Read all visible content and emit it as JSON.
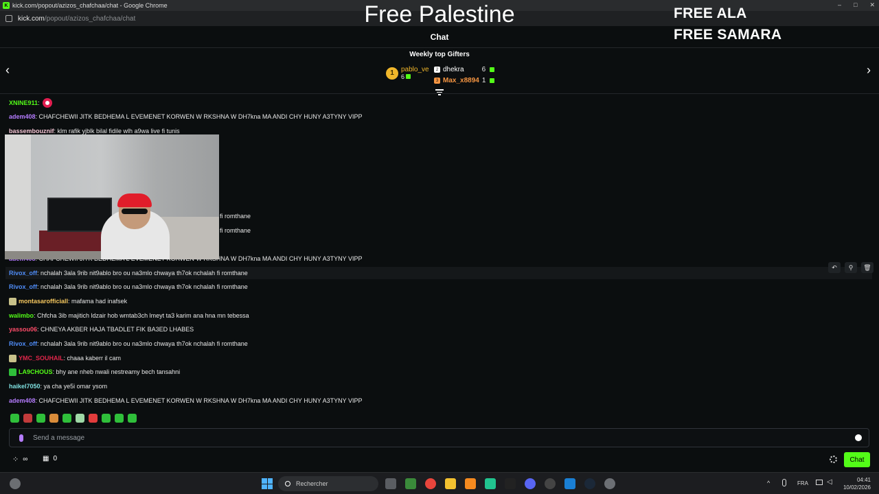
{
  "window": {
    "title": "kick.com/popout/azizos_chafchaa/chat - Google Chrome",
    "url_host": "kick.com",
    "url_path": "/popout/azizos_chafchaa/chat"
  },
  "overlay": {
    "center": "Free Palestine",
    "right_line1": "FREE ALA",
    "right_line2": "FREE SAMARA"
  },
  "chat_header": {
    "title": "Chat"
  },
  "gifters": {
    "title": "Weekly top Gifters",
    "items": [
      {
        "rank": "1",
        "name": "pablo_ve",
        "count": "6",
        "color": "#f1b72b"
      },
      {
        "rank": "2",
        "name": "dhekra",
        "count": "6",
        "color": "#ffffff"
      },
      {
        "rank": "3",
        "name": "Max_x8894",
        "count": "1",
        "color": "#f59542"
      }
    ]
  },
  "messages": [
    {
      "user": "XNINE911",
      "text": "",
      "color": "#53fc18",
      "emote": true
    },
    {
      "user": "adem408",
      "text": ": CHAFCHEWII JITK BEDHEMA L EVEMENET KORWEN W RKSHNA W DH7kna MA ANDI CHY HUNY A3TYNY VIPP",
      "color": "#b57cff"
    },
    {
      "user": "bassembouznif",
      "text": ": klm rafik yjblk bilal fidile wlh a9wa live fi tunis",
      "color": "#f6c6d6"
    },
    {
      "user": "",
      "text": "fi romthane",
      "color": "#e8e8e8"
    },
    {
      "user": "",
      "text": "fi romthane",
      "color": "#e8e8e8"
    },
    {
      "user": "adem408",
      "text": ": CHAFCHEWII JITK BEDHEMA L EVEMENET KORWEN W RKSHNA W DH7kna MA ANDI CHY HUNY A3TYNY VIPP",
      "color": "#b57cff"
    },
    {
      "user": "Rivox_off",
      "text": ": nchalah 3ala 9rib nit9ablo bro ou na3mlo chwaya th7ok nchalah fi romthane",
      "color": "#4f8cf7"
    },
    {
      "user": "Rivox_off",
      "text": ": nchalah 3ala 9rib nit9ablo bro ou na3mlo chwaya th7ok nchalah fi romthane",
      "color": "#4f8cf7"
    },
    {
      "user": "montasarofficiall",
      "text": ": mafama had inafsek",
      "color": "#f6c85f"
    },
    {
      "user": "walimbo",
      "text": ": Chfcha 3ib majitich ldzair hob wmtab3ch lmeyt ta3 karim ana hna mn tebessa",
      "color": "#53fc18"
    },
    {
      "user": "yassou06",
      "text": ": CHNEYA AKBER HAJA TBADLET FIK BA3ED LHABES",
      "color": "#ff4d6a"
    },
    {
      "user": "Rivox_off",
      "text": ": nchalah 3ala 9rib nit9ablo bro ou na3mlo chwaya th7ok nchalah fi romthane",
      "color": "#4f8cf7"
    },
    {
      "user": "YMC_SOUHAIL",
      "text": ": chaaa kaberr il cam",
      "color": "#e0264a"
    },
    {
      "user": "LA9CHOUS",
      "text": ": bhy ane nheb nwali nestreamy bech tansahni",
      "color": "#53fc18"
    },
    {
      "user": "haikel7050",
      "text": ": ya cha ye5i omar ysom",
      "color": "#7fe0e0"
    },
    {
      "user": "adem408",
      "text": ": CHAFCHEWII JITK BEDHEMA L EVEMENET KORWEN W RKSHNA W DH7kna MA ANDI CHY HUNY A3TYNY VIPP",
      "color": "#b57cff"
    }
  ],
  "input": {
    "placeholder": "Send a message"
  },
  "bottom": {
    "points": "0",
    "chat_button": "Chat"
  },
  "taskbar": {
    "search": "Rechercher",
    "lang": "FRA",
    "time": "04:41",
    "date": "10/02/2026"
  }
}
